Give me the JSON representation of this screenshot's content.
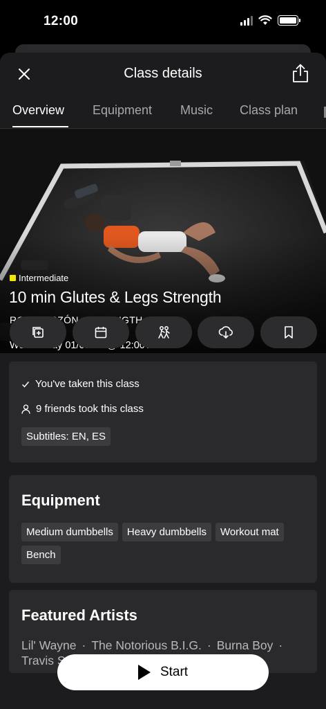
{
  "status_bar": {
    "time": "12:00"
  },
  "header": {
    "title": "Class details"
  },
  "tabs": [
    {
      "label": "Overview",
      "active": true
    },
    {
      "label": "Equipment",
      "active": false
    },
    {
      "label": "Music",
      "active": false
    },
    {
      "label": "Class plan",
      "active": false
    }
  ],
  "hero": {
    "level": "Intermediate",
    "level_color": "#f5e600",
    "title": "10 min Glutes & Legs Strength",
    "meta": "ROBIN ARZÓN · STRENGTH",
    "date": "Wednesday 01/07/26 @ 12:00 AM"
  },
  "actions": [
    {
      "icon": "add-to-stack-icon"
    },
    {
      "icon": "calendar-icon"
    },
    {
      "icon": "take-together-icon"
    },
    {
      "icon": "download-icon"
    },
    {
      "icon": "bookmark-icon"
    }
  ],
  "info": {
    "taken": "You've taken this class",
    "friends": "9 friends took this class",
    "subtitles": "Subtitles: EN, ES"
  },
  "equipment": {
    "heading": "Equipment",
    "items": [
      "Medium dumbbells",
      "Heavy dumbbells",
      "Workout mat",
      "Bench"
    ]
  },
  "featured": {
    "heading": "Featured Artists",
    "artists": [
      "Lil' Wayne",
      "The Notorious B.I.G.",
      "Burna Boy"
    ],
    "artists_line2": "Travis Scott"
  },
  "start_button": {
    "label": "Start"
  }
}
